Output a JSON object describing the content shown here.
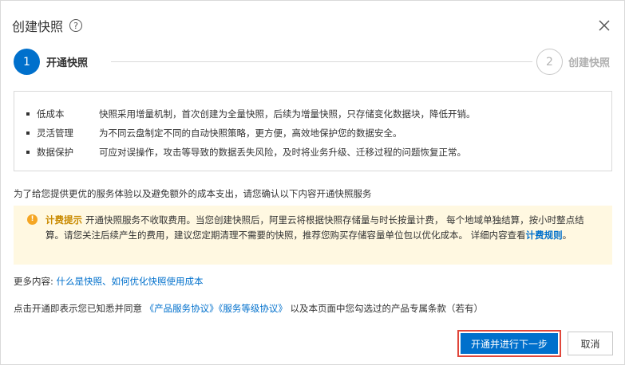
{
  "dialog": {
    "title": "创建快照",
    "help_icon": "question-circle-icon",
    "close_icon": "close-icon"
  },
  "steps": [
    {
      "number": "1",
      "label": "开通快照",
      "active": true
    },
    {
      "number": "2",
      "label": "创建快照",
      "active": false
    }
  ],
  "features": [
    {
      "name": "低成本",
      "desc": "快照采用增量机制，首次创建为全量快照，后续为增量快照，只存储变化数据块，降低开销。"
    },
    {
      "name": "灵活管理",
      "desc": "为不同云盘制定不同的自动快照策略，更方便，高效地保护您的数据安全。"
    },
    {
      "name": "数据保护",
      "desc": "可应对误操作，攻击等导致的数据丢失风险，及时将业务升级、迁移过程的问题恢复正常。"
    }
  ],
  "intro": "为了给您提供更优的服务体验以及避免额外的成本支出，请您确认以下内容开通快照服务",
  "notice": {
    "icon": "warning-icon",
    "title": "计费提示",
    "text": "开通快照服务不收取费用。当您创建快照后，阿里云将根据快照存储量与时长按量计费， 每个地域单独结算，按小时整点结算。请您关注后续产生的费用，建议您定期清理不需要的快照，推荐您购买存储容量单位包以优化成本。 详细内容查看",
    "link_label": "计费规则",
    "end": "。"
  },
  "more": {
    "label": "更多内容: ",
    "link1": "什么是快照",
    "separator": "、",
    "link2": "如何优化快照使用成本"
  },
  "agreement": {
    "prefix": "点击开通即表示您已知悉并同意 ",
    "link1": "《产品服务协议》",
    "link2": "《服务等级协议》",
    "suffix": " 以及本页面中您勾选过的产品专属条款（若有）"
  },
  "buttons": {
    "primary": "开通并进行下一步",
    "cancel": "取消"
  },
  "colors": {
    "accent": "#0070cc",
    "notice_bg": "#fff8e1",
    "notice_title": "#c98a00",
    "highlight_border": "#e0463a"
  }
}
